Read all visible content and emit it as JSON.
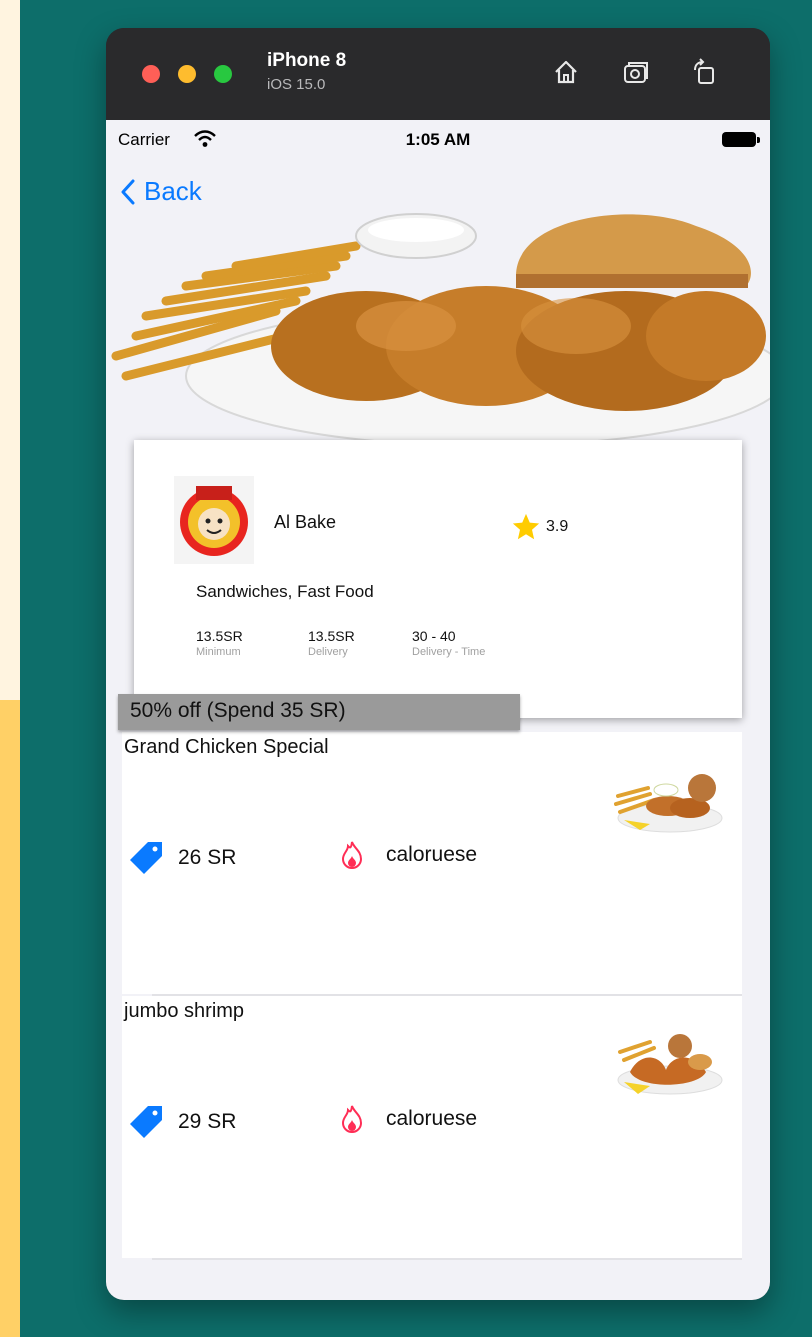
{
  "device": {
    "name": "iPhone 8",
    "os": "iOS 15.0"
  },
  "statusbar": {
    "carrier": "Carrier",
    "time": "1:05 AM"
  },
  "nav": {
    "back_label": "Back"
  },
  "restaurant": {
    "name": "Al Bake",
    "rating": "3.9",
    "categories": "Sandwiches, Fast Food",
    "stats": [
      {
        "value": "13.5SR",
        "label": "Minimum"
      },
      {
        "value": "13.5SR",
        "label": "Delivery"
      },
      {
        "value": "30 - 40",
        "label": "Delivery - Time"
      }
    ]
  },
  "offer": {
    "label": "50% off (Spend 35 SR)"
  },
  "menu": [
    {
      "name": "Grand Chicken Special",
      "price": "26 SR",
      "calories_label": "caloruese"
    },
    {
      "name": "jumbo shrimp",
      "price": "29 SR",
      "calories_label": "caloruese"
    }
  ],
  "colors": {
    "accent": "#0a7aff",
    "star": "#ffcc00",
    "calorie": "#ff2d55",
    "background": "#0d6e6a"
  }
}
